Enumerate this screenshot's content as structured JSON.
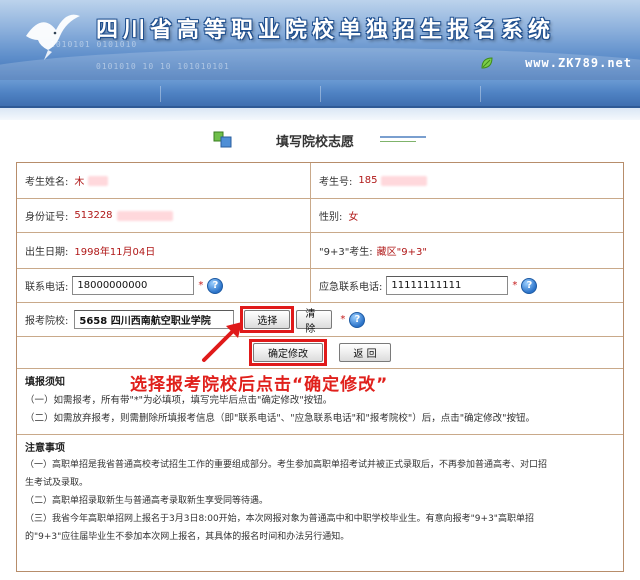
{
  "header": {
    "title": "四川省高等职业院校单独招生报名系统",
    "site": "www.ZK789.net",
    "binary_a": "0101010  10  10 101010101",
    "binary_b": "1010101 0101010"
  },
  "page": {
    "heading": "填写院校志愿"
  },
  "form": {
    "name_label": "考生姓名:",
    "name_value": "木",
    "exam_no_label": "考生号:",
    "exam_no_value": "185",
    "id_label": "身份证号:",
    "id_value": "513228",
    "gender_label": "性别:",
    "gender_value": "女",
    "birth_label": "出生日期:",
    "birth_value": "1998年11月04日",
    "nine_three_label": "\"9+3\"考生:",
    "nine_three_value": "藏区\"9+3\"",
    "phone_label": "联系电话:",
    "phone_value": "18000000000",
    "emergency_label": "应急联系电话:",
    "emergency_value": "11111111111",
    "required_mark": "*",
    "help_glyph": "?",
    "school_label": "报考院校:",
    "school_value": "5658 四川西南航空职业学院",
    "select_button": "选择",
    "clear_button": "清除",
    "confirm_button": "确定修改",
    "back_button": "返 回"
  },
  "annotation": {
    "text": "选择报考院校后点击“确定修改”"
  },
  "notice": {
    "title": "填报须知",
    "items": [
      "（一）如需报考，所有带\"*\"为必填项，填写完毕后点击\"确定修改\"按钮。",
      "（二）如需放弃报考，则需删除所填报考信息（即\"联系电话\"、\"应急联系电话\"和\"报考院校\"）后，点击\"确定修改\"按钮。"
    ]
  },
  "attention": {
    "title": "注意事项",
    "item1_a": "（一）高职单招是我省普通高校考试招生工作的重要组成部分。考生参加高职单招考试并被正式录取后，不再参加普通高考、对口招",
    "item1_b": "生考试及录取。",
    "item2": "（二）高职单招录取新生与普通高考录取新生享受同等待遇。",
    "item3_a": "（三）我省今年高职单招网上报名于3月3日8:00开始，本次网报对象为普通高中和中职学校毕业生。有意向报考\"9+3\"高职单招",
    "item3_b": "的\"9+3\"应往届毕业生不参加本次网上报名，其具体的报名时间和办法另行通知。"
  },
  "colors": {
    "accent_red": "#e01a1a",
    "banner_blue": "#3f72b6",
    "border_brown": "#b78d6b"
  }
}
